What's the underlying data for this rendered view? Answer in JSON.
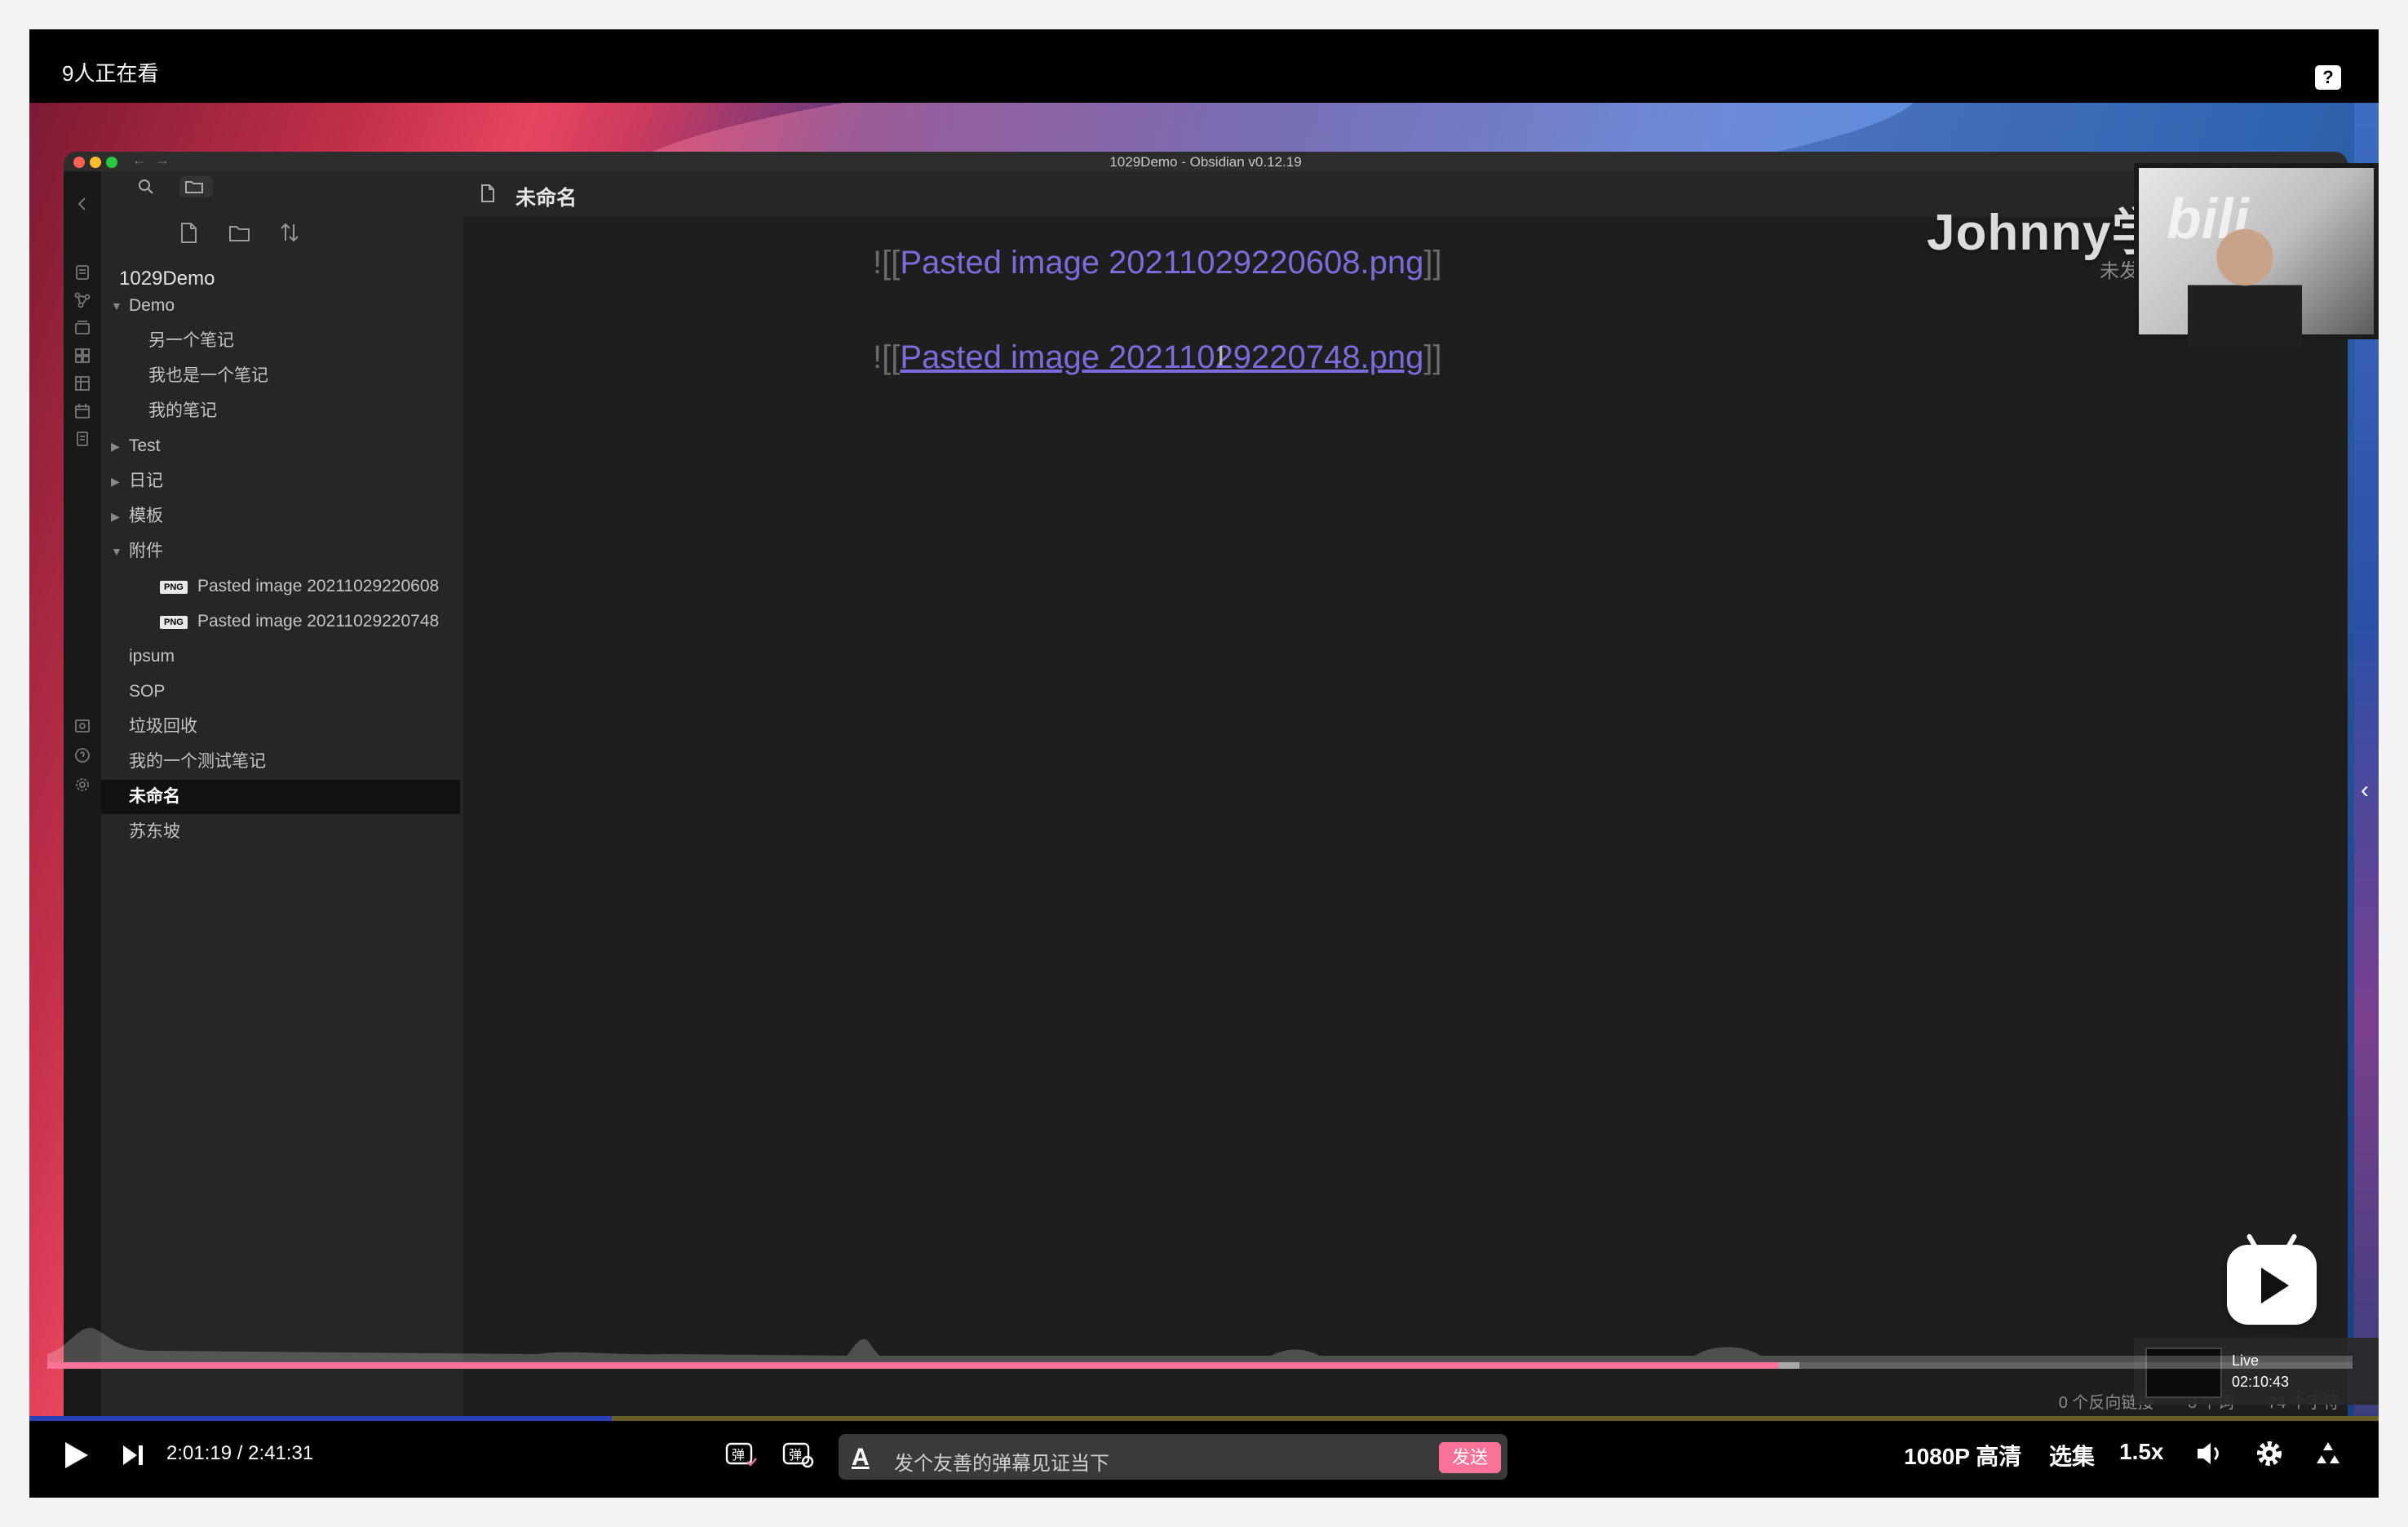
{
  "player": {
    "viewers_text": "9人正在看",
    "help_label": "?"
  },
  "app_window": {
    "title": "1029Demo - Obsidian v0.12.19",
    "vault_name": "1029Demo",
    "tree": [
      {
        "label": "Demo",
        "type": "folder",
        "expanded": true,
        "depth": 0
      },
      {
        "label": "另一个笔记",
        "type": "note",
        "depth": 1
      },
      {
        "label": "我也是一个笔记",
        "type": "note",
        "depth": 1
      },
      {
        "label": "我的笔记",
        "type": "note",
        "depth": 1
      },
      {
        "label": "Test",
        "type": "folder",
        "expanded": false,
        "depth": 0
      },
      {
        "label": "日记",
        "type": "folder",
        "expanded": false,
        "depth": 0
      },
      {
        "label": "模板",
        "type": "folder",
        "expanded": false,
        "depth": 0
      },
      {
        "label": "附件",
        "type": "folder",
        "expanded": true,
        "depth": 0
      },
      {
        "label": "Pasted image 20211029220608",
        "type": "png",
        "depth": 1
      },
      {
        "label": "Pasted image 20211029220748",
        "type": "png",
        "depth": 1
      },
      {
        "label": "ipsum",
        "type": "note",
        "depth": 0
      },
      {
        "label": "SOP",
        "type": "note",
        "depth": 0
      },
      {
        "label": "垃圾回收",
        "type": "note",
        "depth": 0
      },
      {
        "label": "我的一个测试笔记",
        "type": "note",
        "depth": 0
      },
      {
        "label": "未命名",
        "type": "note",
        "depth": 0,
        "active": true
      },
      {
        "label": "苏东坡",
        "type": "note",
        "depth": 0
      }
    ],
    "png_tag": "PNG",
    "tab_title": "未命名",
    "editor_lines": [
      {
        "open": "![[",
        "link": "Pasted image 20211029220608.png",
        "close": "]]"
      },
      {
        "open": "![[",
        "link": "Pasted image 20211029220748.png",
        "close": "]]"
      }
    ],
    "status": {
      "backlinks": "0 个反向链接",
      "words": "8 个词",
      "chars": "74 个字符"
    },
    "unsent_badge": "未发"
  },
  "overlay": {
    "watermark": "Johnny学",
    "live_label": "Live",
    "live_time": "02:10:43"
  },
  "playback": {
    "current_time": "2:01:19",
    "separator": "/",
    "total_time": "2:41:31",
    "progress_fraction": 0.751,
    "buffered_fraction": 0.76
  },
  "danmaku": {
    "placeholder": "发个友善的弹幕见证当下",
    "send_label": "发送",
    "a_label": "A"
  },
  "right_controls": {
    "quality": "1080P 高清",
    "episodes": "选集",
    "speed": "1.5x"
  },
  "colors": {
    "accent_pink": "#fb7299",
    "link_purple": "#7b6cdb"
  },
  "icons": [
    "help-icon",
    "search-icon",
    "folder-icon",
    "new-note-icon",
    "new-folder-icon",
    "sort-icon",
    "doc-icon",
    "play-icon",
    "next-icon",
    "danmaku-toggle-icon",
    "danmaku-settings-icon",
    "volume-icon",
    "settings-icon",
    "fullscreen-icon",
    "bilibili-tv-icon"
  ]
}
